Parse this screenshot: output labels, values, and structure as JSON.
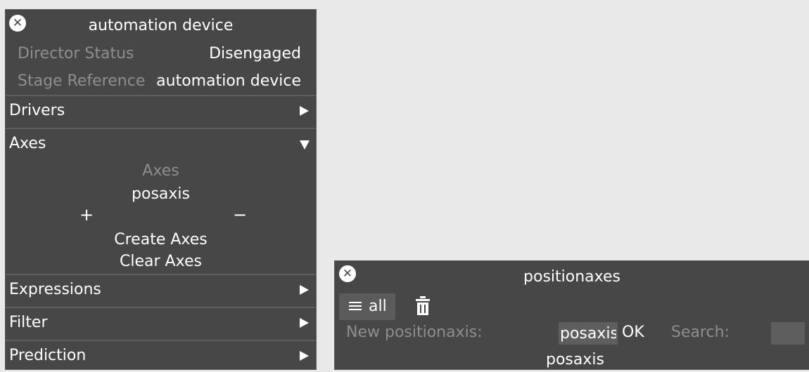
{
  "device_panel": {
    "title": "automation device",
    "close_icon": "close-icon",
    "properties": [
      {
        "label": "Director Status",
        "value": "Disengaged"
      },
      {
        "label": "Stage Reference",
        "value": "automation device"
      }
    ],
    "sections": {
      "drivers": {
        "label": "Drivers",
        "expanded": false
      },
      "axes": {
        "label": "Axes",
        "expanded": true,
        "list_title": "Axes",
        "items": [
          "posaxis"
        ],
        "add_symbol": "+",
        "remove_symbol": "−",
        "create_label": "Create Axes",
        "clear_label": "Clear Axes"
      },
      "expressions": {
        "label": "Expressions",
        "expanded": false
      },
      "filter": {
        "label": "Filter",
        "expanded": false
      },
      "prediction": {
        "label": "Prediction",
        "expanded": false
      }
    }
  },
  "axes_panel": {
    "title": "positionaxes",
    "close_icon": "close-icon",
    "filter_button": {
      "label": "all",
      "icon": "list-icon"
    },
    "delete_icon": "trash-icon",
    "new_label": "New positionaxis:",
    "new_value": "posaxis",
    "ok_label": "OK",
    "search_label": "Search:",
    "search_value": "",
    "items": [
      "posaxis"
    ]
  },
  "colors": {
    "background": "#e8e9e8",
    "panel": "#474747",
    "muted_text": "#8e8e8e",
    "text": "#ffffff"
  }
}
